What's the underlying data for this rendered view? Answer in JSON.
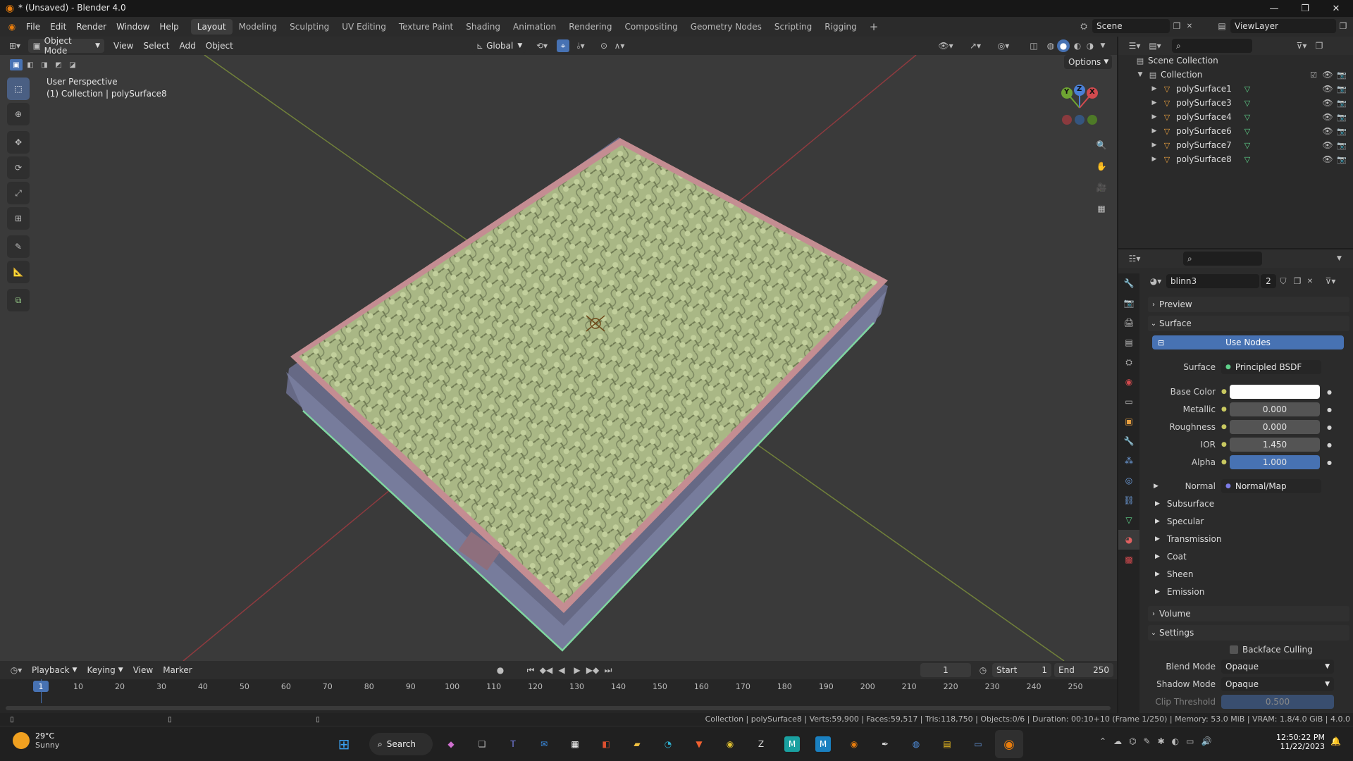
{
  "window": {
    "title": "* (Unsaved) - Blender 4.0"
  },
  "menu": [
    "File",
    "Edit",
    "Render",
    "Window",
    "Help"
  ],
  "workspaces": [
    "Layout",
    "Modeling",
    "Sculpting",
    "UV Editing",
    "Texture Paint",
    "Shading",
    "Animation",
    "Rendering",
    "Compositing",
    "Geometry Nodes",
    "Scripting",
    "Rigging"
  ],
  "active_workspace": "Layout",
  "scene": {
    "name": "Scene",
    "view_layer": "ViewLayer"
  },
  "viewport_header": {
    "mode": "Object Mode",
    "menus": [
      "View",
      "Select",
      "Add",
      "Object"
    ],
    "orientation": "Global",
    "options": "Options"
  },
  "viewport": {
    "perspective": "User Perspective",
    "collection_info": "(1) Collection | polySurface8"
  },
  "gizmo": {
    "x": "X",
    "y": "Y",
    "z": "Z"
  },
  "outliner": {
    "scene_collection": "Scene Collection",
    "collection": "Collection",
    "items": [
      "polySurface1",
      "polySurface3",
      "polySurface4",
      "polySurface6",
      "polySurface7",
      "polySurface8"
    ]
  },
  "properties": {
    "material_name": "blinn3",
    "material_users": "2",
    "sections": {
      "preview": "Preview",
      "surface": "Surface",
      "volume": "Volume",
      "settings": "Settings"
    },
    "use_nodes": "Use Nodes",
    "surface_label": "Surface",
    "surface_value": "Principled BSDF",
    "fields": [
      {
        "label": "Base Color",
        "value": ""
      },
      {
        "label": "Metallic",
        "value": "0.000"
      },
      {
        "label": "Roughness",
        "value": "0.000"
      },
      {
        "label": "IOR",
        "value": "1.450"
      },
      {
        "label": "Alpha",
        "value": "1.000"
      }
    ],
    "normal_label": "Normal",
    "normal_value": "Normal/Map",
    "subpanels": [
      "Subsurface",
      "Specular",
      "Transmission",
      "Coat",
      "Sheen",
      "Emission"
    ],
    "backface_culling": "Backface Culling",
    "blend_mode_label": "Blend Mode",
    "blend_mode": "Opaque",
    "shadow_mode_label": "Shadow Mode",
    "shadow_mode": "Opaque",
    "clip_threshold_label": "Clip Threshold",
    "clip_threshold": "0.500"
  },
  "timeline": {
    "menus": [
      "Playback",
      "Keying",
      "View",
      "Marker"
    ],
    "current_frame": "1",
    "start_label": "Start",
    "start": "1",
    "end_label": "End",
    "end": "250",
    "ticks": [
      "1",
      "10",
      "20",
      "30",
      "40",
      "50",
      "60",
      "70",
      "80",
      "90",
      "100",
      "110",
      "120",
      "130",
      "140",
      "150",
      "160",
      "170",
      "180",
      "190",
      "200",
      "210",
      "220",
      "230",
      "240",
      "250"
    ]
  },
  "status_bar": "Collection | polySurface8 | Verts:59,900 | Faces:59,517 | Tris:118,750 | Objects:0/6 | Duration: 00:10+10 (Frame 1/250) | Memory: 53.0 MiB | VRAM: 1.8/4.0 GiB | 4.0.0",
  "taskbar": {
    "weather_temp": "29°C",
    "weather_desc": "Sunny",
    "search": "Search",
    "time": "12:50:22 PM",
    "date": "11/22/2023"
  },
  "colors": {
    "accent": "#4772b3",
    "mattress_top": "#aab883",
    "mattress_side": "#6c6f8a"
  }
}
